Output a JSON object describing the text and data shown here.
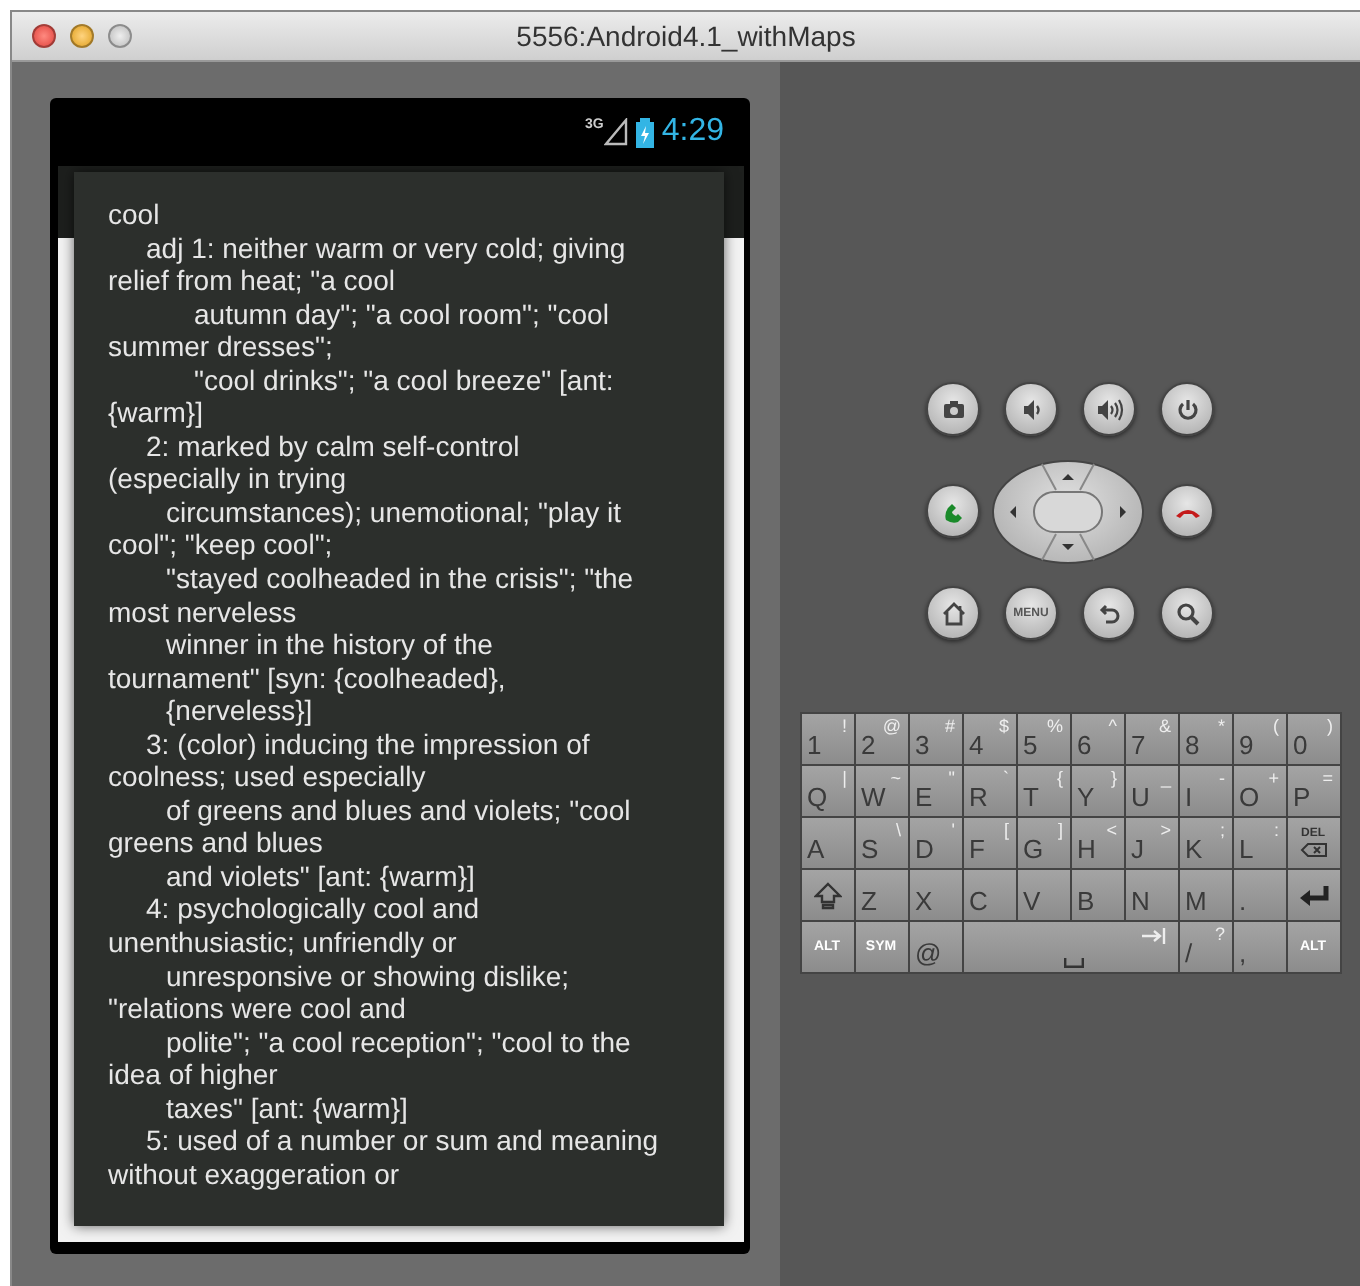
{
  "window": {
    "title": "5556:Android4.1_withMaps"
  },
  "status_bar": {
    "network": "3G",
    "time": "4:29"
  },
  "dialog": {
    "lines": [
      {
        "kind": "flush",
        "text": "cool"
      },
      {
        "kind": "sense",
        "text": "adj 1: neither warm or very cold; giving"
      },
      {
        "kind": "flush",
        "text": "relief from heat; \"a cool"
      },
      {
        "kind": "deep",
        "text": "autumn day\"; \"a cool room\"; \"cool"
      },
      {
        "kind": "flush",
        "text": "summer dresses\";"
      },
      {
        "kind": "deep",
        "text": "\"cool drinks\"; \"a cool breeze\" [ant:"
      },
      {
        "kind": "flush",
        "text": "{warm}]"
      },
      {
        "kind": "sense",
        "text": "2: marked by calm self-control"
      },
      {
        "kind": "flush",
        "text": "(especially in trying"
      },
      {
        "kind": "cont",
        "text": "circumstances); unemotional; \"play it"
      },
      {
        "kind": "flush",
        "text": "cool\"; \"keep cool\";"
      },
      {
        "kind": "cont",
        "text": "\"stayed coolheaded in the crisis\"; \"the"
      },
      {
        "kind": "flush",
        "text": "most nerveless"
      },
      {
        "kind": "cont",
        "text": "winner in the history of the"
      },
      {
        "kind": "flush",
        "text": "tournament\" [syn: {coolheaded},"
      },
      {
        "kind": "cont",
        "text": "{nerveless}]"
      },
      {
        "kind": "sense",
        "text": "3: (color) inducing the impression of"
      },
      {
        "kind": "flush",
        "text": "coolness; used especially"
      },
      {
        "kind": "cont",
        "text": "of greens and blues and violets; \"cool"
      },
      {
        "kind": "flush",
        "text": "greens and blues"
      },
      {
        "kind": "cont",
        "text": "and violets\" [ant: {warm}]"
      },
      {
        "kind": "sense",
        "text": "4: psychologically cool and"
      },
      {
        "kind": "flush",
        "text": "unenthusiastic; unfriendly or"
      },
      {
        "kind": "cont",
        "text": "unresponsive or showing dislike;"
      },
      {
        "kind": "flush",
        "text": "\"relations were cool and"
      },
      {
        "kind": "cont",
        "text": "polite\"; \"a cool reception\"; \"cool to the"
      },
      {
        "kind": "flush",
        "text": "idea of higher"
      },
      {
        "kind": "cont",
        "text": "taxes\" [ant: {warm}]"
      },
      {
        "kind": "sense",
        "text": "5: used of a number or sum and meaning"
      },
      {
        "kind": "flush",
        "text": "without exaggeration or"
      }
    ]
  },
  "controls": {
    "menu_label": "MENU"
  },
  "keyboard": {
    "rows": [
      [
        {
          "kind": "char",
          "label": "1",
          "alt": "!"
        },
        {
          "kind": "char",
          "label": "2",
          "alt": "@"
        },
        {
          "kind": "char",
          "label": "3",
          "alt": "#"
        },
        {
          "kind": "char",
          "label": "4",
          "alt": "$"
        },
        {
          "kind": "char",
          "label": "5",
          "alt": "%"
        },
        {
          "kind": "char",
          "label": "6",
          "alt": "^"
        },
        {
          "kind": "char",
          "label": "7",
          "alt": "&"
        },
        {
          "kind": "char",
          "label": "8",
          "alt": "*"
        },
        {
          "kind": "char",
          "label": "9",
          "alt": "("
        },
        {
          "kind": "char",
          "label": "0",
          "alt": ")"
        }
      ],
      [
        {
          "kind": "char",
          "label": "Q",
          "alt": "|"
        },
        {
          "kind": "char",
          "label": "W",
          "alt": "~"
        },
        {
          "kind": "char",
          "label": "E",
          "alt": "\""
        },
        {
          "kind": "char",
          "label": "R",
          "alt": "`"
        },
        {
          "kind": "char",
          "label": "T",
          "alt": "{"
        },
        {
          "kind": "char",
          "label": "Y",
          "alt": "}"
        },
        {
          "kind": "char",
          "label": "U",
          "alt": "_"
        },
        {
          "kind": "char",
          "label": "I",
          "alt": "-"
        },
        {
          "kind": "char",
          "label": "O",
          "alt": "+"
        },
        {
          "kind": "char",
          "label": "P",
          "alt": "="
        }
      ],
      [
        {
          "kind": "char",
          "label": "A"
        },
        {
          "kind": "char",
          "label": "S",
          "alt": "\\"
        },
        {
          "kind": "char",
          "label": "D",
          "alt": "'"
        },
        {
          "kind": "char",
          "label": "F",
          "alt": "["
        },
        {
          "kind": "char",
          "label": "G",
          "alt": "]"
        },
        {
          "kind": "char",
          "label": "H",
          "alt": "<"
        },
        {
          "kind": "char",
          "label": "J",
          "alt": ">"
        },
        {
          "kind": "char",
          "label": "K",
          "alt": ";"
        },
        {
          "kind": "char",
          "label": "L",
          "alt": ":"
        },
        {
          "kind": "del",
          "label": "DEL"
        }
      ],
      [
        {
          "kind": "shift"
        },
        {
          "kind": "char",
          "label": "Z"
        },
        {
          "kind": "char",
          "label": "X"
        },
        {
          "kind": "char",
          "label": "C"
        },
        {
          "kind": "char",
          "label": "V"
        },
        {
          "kind": "char",
          "label": "B"
        },
        {
          "kind": "char",
          "label": "N"
        },
        {
          "kind": "char",
          "label": "M"
        },
        {
          "kind": "char",
          "label": "."
        },
        {
          "kind": "enter"
        }
      ],
      [
        {
          "kind": "mod",
          "label": "ALT"
        },
        {
          "kind": "mod",
          "label": "SYM"
        },
        {
          "kind": "char",
          "label": "@"
        },
        {
          "kind": "space"
        },
        "",
        "",
        "",
        {
          "kind": "char",
          "label": "/",
          "alt": "?"
        },
        {
          "kind": "char",
          "label": ","
        },
        {
          "kind": "mod",
          "label": "ALT"
        }
      ]
    ]
  }
}
